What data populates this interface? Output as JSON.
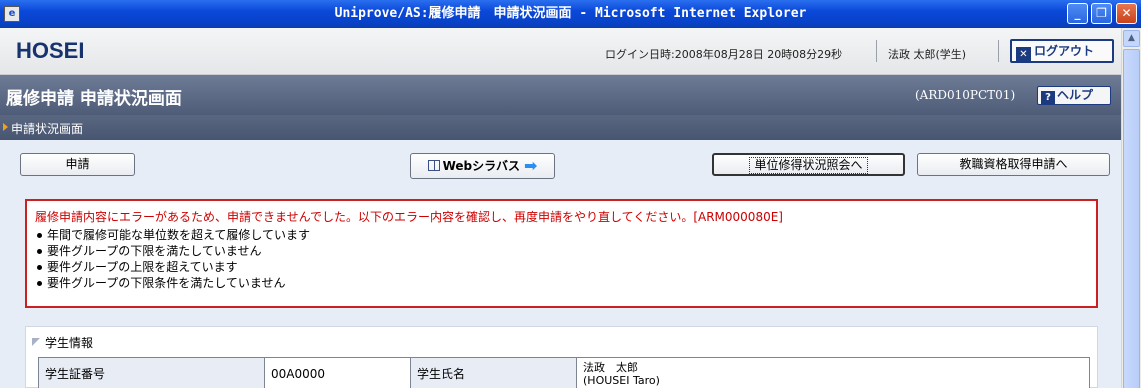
{
  "window": {
    "title": "Uniprove/AS:履修申請　申請状況画面 - Microsoft Internet Explorer"
  },
  "header": {
    "logo": "HOSEI",
    "login_time": "ログイン日時:2008年08月28日 20時08分29秒",
    "user": "法政 太郎(学生)",
    "logout_label": "ログアウト"
  },
  "page": {
    "title": "履修申請 申請状況画面",
    "code": "(ARD010PCT01)",
    "help_label": "ヘルプ",
    "breadcrumb": "申請状況画面"
  },
  "toolbar": {
    "apply_label": "申請",
    "syllabus_label": "Webシラバス",
    "credits_label": "単位修得状況照会へ",
    "teaching_label": "教職資格取得申請へ"
  },
  "errors": {
    "message": "履修申請内容にエラーがあるため、申請できませんでした。以下のエラー内容を確認し、再度申請をやり直してください。[ARM000080E]",
    "items": [
      "年間で履修可能な単位数を超えて履修しています",
      "要件グループの下限を満たしていません",
      "要件グループの上限を超えています",
      "要件グループの下限条件を満たしていません"
    ]
  },
  "student": {
    "section_title": "学生情報",
    "id_label": "学生証番号",
    "id_value": "00A0000",
    "name_label": "学生氏名",
    "name_value": "法政　太郎",
    "name_romaji": "(HOUSEI Taro)"
  },
  "colors": {
    "titlebar": "#0a48d8",
    "pagebar": "#5a6781",
    "error": "#cc1f1f",
    "brand": "#17336e"
  }
}
